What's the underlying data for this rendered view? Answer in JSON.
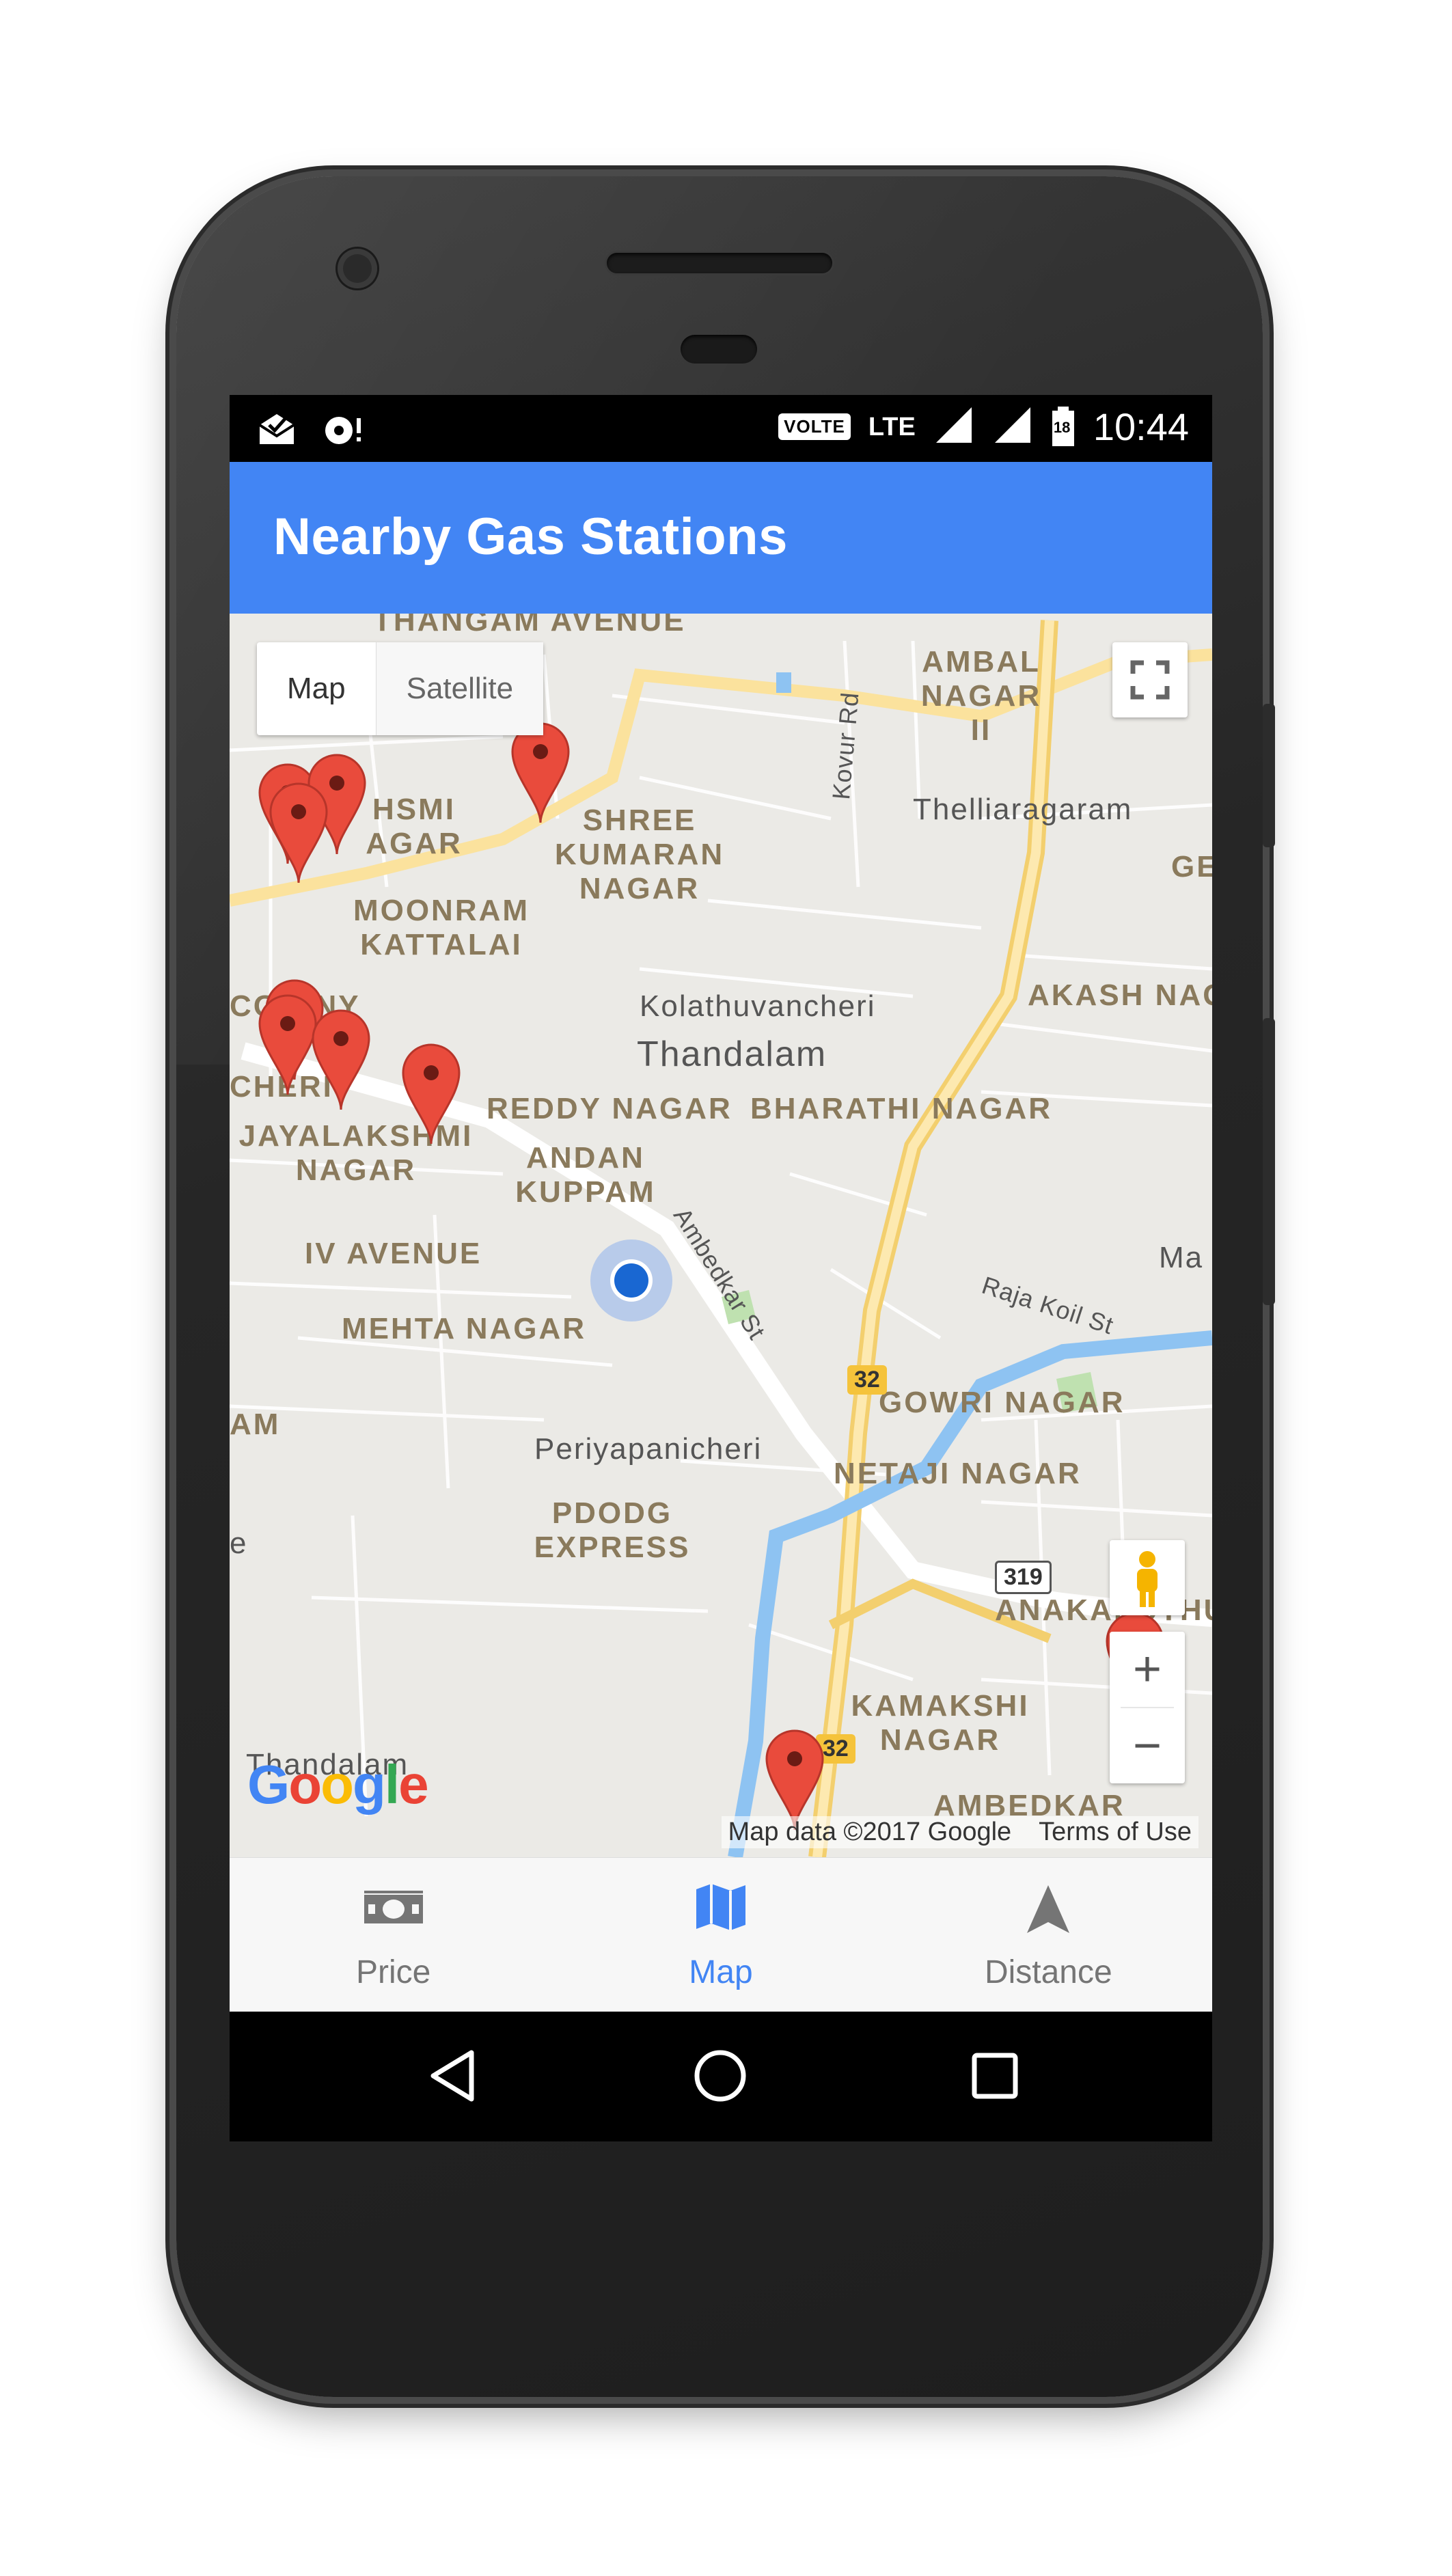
{
  "status_bar": {
    "volte": "VOLTE",
    "network": "LTE",
    "battery": "18",
    "time": "10:44",
    "left_icons": [
      "mail-check-icon",
      "hotspot-alert-icon"
    ]
  },
  "app_bar": {
    "title": "Nearby Gas Stations"
  },
  "map": {
    "type_toggle": {
      "map_label": "Map",
      "satellite_label": "Satellite",
      "selected": "Map"
    },
    "labels": {
      "thangam_avenue": "THANGAM AVENUE",
      "ambal_nagar": "AMBAL NAGAR II",
      "lakshmi_nagar": "HSMI AGAR",
      "shree_kumaran": "SHREE KUMARAN NAGAR",
      "kovur_rd": "Kovur Rd",
      "thelliaragaram": "Thelliaragaram",
      "ge": "GE",
      "moonram_kattalai": "MOONRAM KATTALAI",
      "kolathuvancheri": "Kolathuvancheri",
      "thandalam": "Thandalam",
      "akash_nagar": "AKASH NAG",
      "colony": "CO ONY",
      "cheri": "CHERI",
      "jayalakshmi_nagar": "JAYALAKSHMI NAGAR",
      "reddy_nagar": "REDDY NAGAR",
      "bharathi_nagar": "BHARATHI NAGAR",
      "andan_kuppam": "ANDAN KUPPAM",
      "ambedkar_st": "Ambedkar St",
      "iv_avenue": "IV AVENUE",
      "ma": "Ma",
      "raja_koil_st": "Raja Koil St",
      "mehta_nagar": "MEHTA NAGAR",
      "gowri_nagar": "GOWRI NAGAR",
      "am": "AM",
      "periyapanicheri": "Periyapanicheri",
      "netaji_nagar": "NETAJI NAGAR",
      "pdodg_express": "PDODG EXPRESS",
      "e": "e",
      "anakaputhur": "ANAKAPUTHU",
      "kamakshi_nagar": "KAMAKSHI NAGAR",
      "thandalam_bottom": "Thandalam",
      "ambedkar": "AMBEDKAR",
      "highway_32": "32",
      "highway_319": "319"
    },
    "google_logo": "Google",
    "attribution": "Map data ©2017 Google",
    "terms": "Terms of Use",
    "zoom_in": "+",
    "zoom_out": "−",
    "gas_station_markers": 11,
    "colors": {
      "water": "#7fb8ee",
      "highway": "#f9d98a",
      "marker": "#e94b3c",
      "location": "#1967d2"
    }
  },
  "bottom_nav": {
    "items": [
      {
        "label": "Price",
        "icon": "money-icon",
        "active": false
      },
      {
        "label": "Map",
        "icon": "map-icon",
        "active": true
      },
      {
        "label": "Distance",
        "icon": "navigation-arrow-icon",
        "active": false
      }
    ]
  },
  "system_nav": {
    "back": "back-triangle-icon",
    "home": "home-circle-icon",
    "recents": "recents-square-icon"
  }
}
